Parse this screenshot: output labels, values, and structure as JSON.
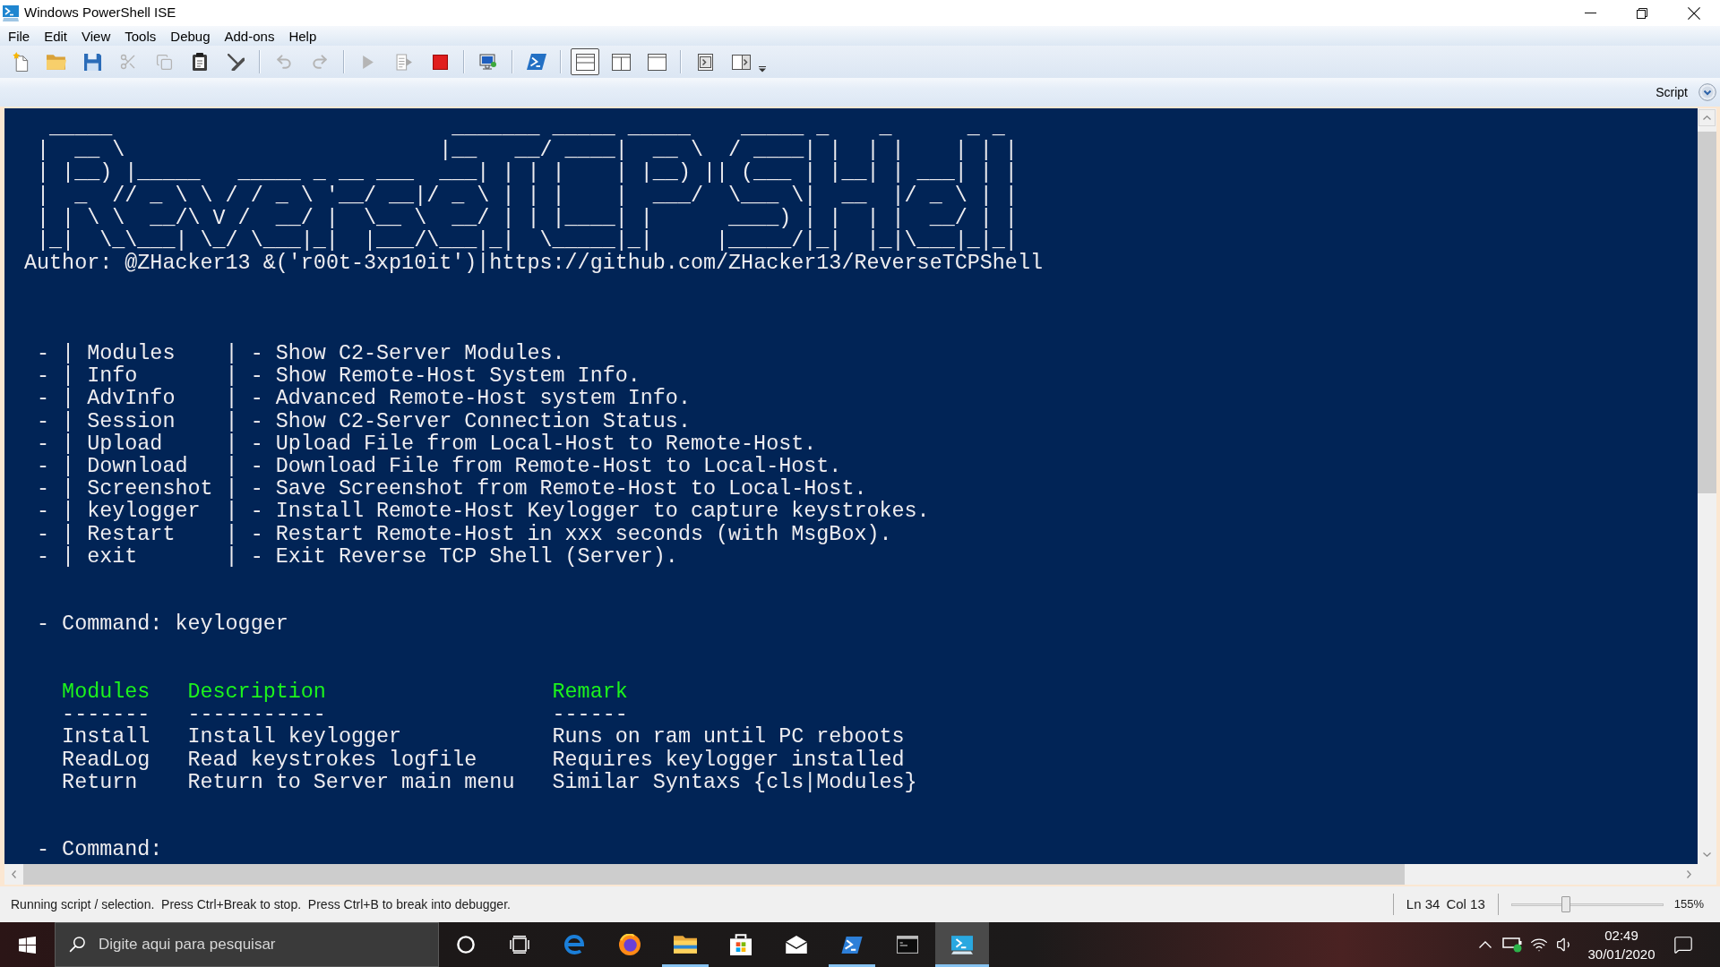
{
  "window": {
    "title": "Windows PowerShell ISE"
  },
  "menu": [
    "File",
    "Edit",
    "View",
    "Tools",
    "Debug",
    "Add-ons",
    "Help"
  ],
  "toolbar": {
    "groups": [
      [
        {
          "disabled": false
        },
        {
          "disabled": false
        },
        {
          "disabled": false
        },
        {
          "disabled": true
        },
        {
          "disabled": true
        },
        {
          "disabled": false
        },
        {
          "disabled": false
        }
      ],
      [
        {
          "disabled": true
        },
        {
          "disabled": true
        }
      ],
      [
        {
          "disabled": true
        },
        {
          "disabled": true
        },
        {
          "disabled": false
        }
      ],
      [
        {
          "disabled": false
        }
      ],
      [
        {
          "disabled": false
        }
      ]
    ],
    "pane_layouts": [
      {
        "selected": true
      },
      {
        "selected": false
      },
      {
        "selected": false
      }
    ],
    "extras": [
      {
        "disabled": false
      },
      {
        "disabled": false
      }
    ]
  },
  "script_pane": {
    "label": "Script",
    "expanded": false
  },
  "console": {
    "banner": [
      " _____                           _______ _____ _____    _____ _    _      _ _",
      "|  __ \\                         |__   __/ ____|  __ \\  / ____| |  | |    | | |",
      "| |__) |_____   _____ _ __ ___  ___| | | |    | |__) || (___ | |__| | ___| | |",
      "|  _  // _ \\ \\ / / _ \\ '__/ __|/ _ \\ | | |    |  ___/  \\___ \\|  __  |/ _ \\ | |",
      "| | \\ \\  __/\\ V /  __/ |  \\__ \\  __/ | | |____| |      ____) | |  | |  __/ | |",
      "|_|  \\_\\___| \\_/ \\___|_|  |___/\\___|_|  \\_____|_|     |_____/|_|  |_|\\___|_|_|"
    ],
    "author": "Author: @ZHacker13 &('r00t-3xp10it')|https://github.com/ZHacker13/ReverseTCPShell",
    "help_lines": [
      "- | Modules    | - Show C2-Server Modules.",
      "- | Info       | - Show Remote-Host System Info.",
      "- | AdvInfo    | - Advanced Remote-Host system Info.",
      "- | Session    | - Show C2-Server Connection Status.",
      "- | Upload     | - Upload File from Local-Host to Remote-Host.",
      "- | Download   | - Download File from Remote-Host to Local-Host.",
      "- | Screenshot | - Save Screenshot from Remote-Host to Local-Host.",
      "- | keylogger  | - Install Remote-Host Keylogger to capture keystrokes.",
      "- | Restart    | - Restart Remote-Host in xxx seconds (with MsgBox).",
      "- | exit       | - Exit Reverse TCP Shell (Server)."
    ],
    "prompts": [
      "- Command: keylogger",
      "- Command:"
    ],
    "table": {
      "columns": [
        "Modules",
        "Description",
        "Remark"
      ],
      "rules": [
        "-------",
        "-----------",
        "------"
      ],
      "rows": [
        [
          "Install",
          "Install keylogger",
          "Runs on ram until PC reboots"
        ],
        [
          "ReadLog",
          "Read keystrokes logfile",
          "Requires keylogger installed"
        ],
        [
          "Return",
          "Return to Server main menu",
          "Similar Syntaxs {cls|Modules}"
        ]
      ]
    }
  },
  "status_bar": {
    "message": "Running script / selection.  Press Ctrl+Break to stop.  Press Ctrl+B to break into debugger.",
    "line": "Ln 34",
    "column": "Col 13",
    "zoom": {
      "level": 0.36,
      "reading": "155%"
    }
  },
  "taskbar": {
    "search": {
      "placeholder": "Digite aqui para pesquisar"
    },
    "apps": [
      {
        "running": false,
        "selected": false
      },
      {
        "running": false,
        "selected": false
      },
      {
        "running": true,
        "selected": false
      },
      {
        "running": false,
        "selected": false
      },
      {
        "running": false,
        "selected": false
      },
      {
        "running": true,
        "selected": false
      },
      {
        "running": false,
        "selected": false
      },
      {
        "running": true,
        "selected": true
      }
    ],
    "clock": {
      "time": "02:49",
      "date": "30/01/2020"
    }
  }
}
